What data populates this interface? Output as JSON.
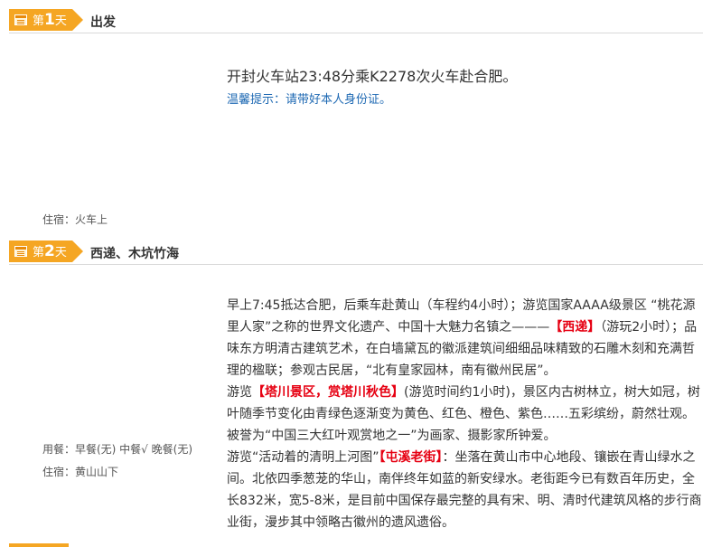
{
  "days": [
    {
      "label_prefix": "第",
      "number": "1",
      "label_suffix": "天",
      "title": "出发",
      "main_text": "开封火车站23:48分乘K2278次火车赴合肥。",
      "tip": "温馨提示：请带好本人身份证。",
      "lodging": "住宿：火车上"
    },
    {
      "label_prefix": "第",
      "number": "2",
      "label_suffix": "天",
      "title": "西递、木坑竹海",
      "meals": "用餐：早餐(无)  中餐√  晚餐(无)",
      "lodging": "住宿：黄山山下",
      "paragraphs": [
        {
          "t1": "早上7:45抵达合肥，后乘车赴黄山（车程约4小时）；游览国家AAAA级景区 “桃花源里人家”之称的世界文化遗产、中国十大魅力名镇之———",
          "h1": "【西递】",
          "t2": "（游玩2小时）；品味东方明清古建筑艺术，在白墙黛瓦的徽派建筑间细细品味精致的石雕木刻和充满哲理的楹联；参观古民居，“北有皇家园林，南有徽州民居”。"
        },
        {
          "t1": "游览",
          "h1": "【塔川景区，赏塔川秋色】",
          "t2": "(游览时间约1小时)，景区内古树林立，树大如冠，树叶随季节变化由青绿色逐渐变为黄色、红色、橙色、紫色……五彩缤纷，蔚然壮观。被誉为“中国三大红叶观赏地之一”为画家、摄影家所钟爱。"
        },
        {
          "t1": "游览“活动着的清明上河图”",
          "h1": "【屯溪老街】",
          "t2": "：坐落在黄山市中心地段、镶嵌在青山绿水之间。北依四季葱茏的华山，南伴终年如蓝的新安绿水。老街距今已有数百年历史，全长832米，宽5-8米，是目前中国保存最完整的具有宋、明、清时代建筑风格的步行商业街，漫步其中领略古徽州的遗风遗俗。"
        }
      ]
    }
  ],
  "colors": {
    "tag": "#f5a623",
    "highlight": "#e60012",
    "tip": "#1e69b3"
  },
  "icons": {
    "day_tag": "calendar-icon"
  }
}
